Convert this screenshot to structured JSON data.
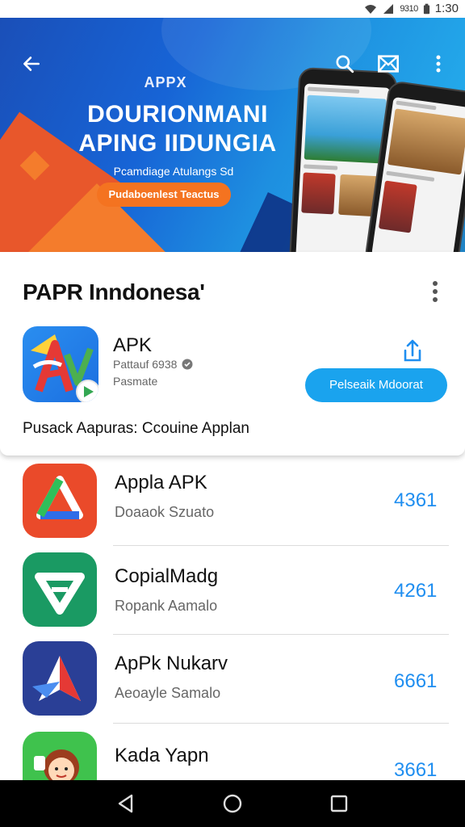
{
  "status_bar": {
    "signal_text": "9310",
    "time": "1:30"
  },
  "banner": {
    "small_title": "APPX",
    "title_line1": "DOURIONMANI",
    "title_line2": "APING IIDUNGIA",
    "subtitle": "Pcamdiage Atulangs Sd",
    "cta_label": "Pudaboenlest Teactus"
  },
  "featured": {
    "title": "PAPR Inndonesa'",
    "app_name": "APK",
    "meta1": "Pattauf 6938",
    "meta2": "Pasmate",
    "install_label": "Pelseaik Mdoorat",
    "caption": "Pusack Aapuras: Ccouine Applan"
  },
  "apps": [
    {
      "name": "Appla APK",
      "subtitle": "Doaaok Szuato",
      "rating": "4361"
    },
    {
      "name": "CopialMadg",
      "subtitle": "Ropank Aamalo",
      "rating": "4261"
    },
    {
      "name": "ApPk Nukarv",
      "subtitle": "Aeoayle Samalo",
      "rating": "6661"
    },
    {
      "name": "Kada Yapn",
      "subtitle": "",
      "rating": "3661"
    }
  ],
  "colors": {
    "accent": "#1aa3ee",
    "rating": "#1f8ef0",
    "banner_cta": "#f47320"
  }
}
